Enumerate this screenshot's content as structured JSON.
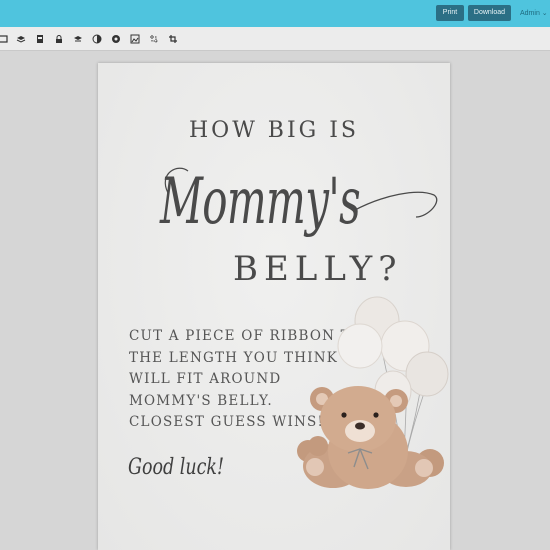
{
  "topbar": {
    "print_label": "Print",
    "download_label": "Download",
    "admin_label": "Admin ⌄",
    "bar_color": "#4fc4de",
    "button_color": "#2b6f85"
  },
  "toolbar": {
    "tools": [
      "layers-icon",
      "stack-icon",
      "page-icon",
      "lock-icon",
      "layer-down-icon",
      "contrast-icon",
      "palette-icon",
      "image-icon",
      "crop-alt-icon",
      "crop-icon"
    ]
  },
  "poster": {
    "line1": "HOW BIG IS",
    "line2": "Mommy's",
    "line3": "BELLY?",
    "body": [
      "CUT A PIECE OF RIBBON TO",
      "THE LENGTH YOU THINK",
      "WILL FIT AROUND",
      "MOMMY'S BELLY.",
      "CLOSEST GUESS WINS!"
    ],
    "signoff": "Good luck!",
    "text_color": "#4a4a4a"
  }
}
